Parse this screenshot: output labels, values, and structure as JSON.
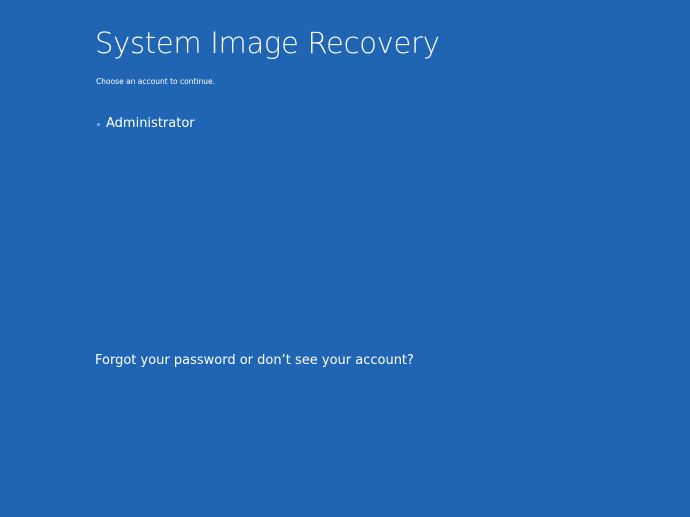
{
  "page": {
    "title": "System Image Recovery",
    "subtitle": "Choose an account to continue."
  },
  "accounts": [
    {
      "label": "Administrator"
    }
  ],
  "links": {
    "forgot_password": "Forgot your password or don’t see your account?"
  },
  "colors": {
    "background": "#1f65b3",
    "text": "#ffffff",
    "bullet": "#6fb2f0"
  },
  "icons": {
    "account_bullet": "bullet-icon"
  }
}
